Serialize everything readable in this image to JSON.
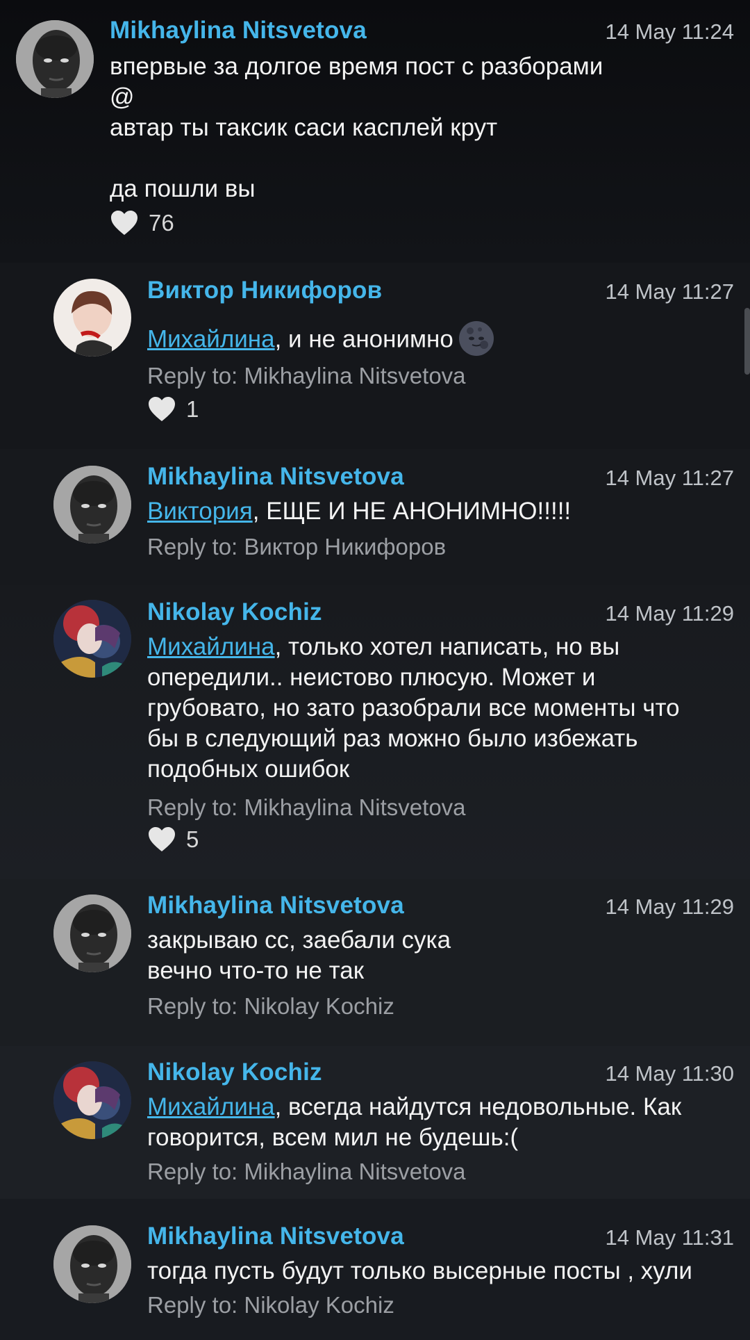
{
  "comments": [
    {
      "author": "Mikhaylina Nitsvetova",
      "time": "14 May 11:24",
      "text": "впервые за долгое время пост с разборами\n@\nавтар ты таксик саси касплей крут\n\nда пошли вы",
      "likes": "76"
    },
    {
      "author": "Виктор Никифоров",
      "time": "14 May 11:27",
      "mention": "Михайлина",
      "text": ", и не анонимно",
      "emoji": "new-moon-face-emoji",
      "reply": "Reply to: Mikhaylina Nitsvetova",
      "likes": "1"
    },
    {
      "author": "Mikhaylina Nitsvetova",
      "time": "14 May 11:27",
      "mention": "Виктория",
      "text": ", ЕЩЕ И НЕ АНОНИМНО!!!!!",
      "reply": "Reply to: Виктор Никифоров"
    },
    {
      "author": "Nikolay Kochiz",
      "time": "14 May 11:29",
      "mention": "Михайлина",
      "text": ", только хотел написать, но вы\nопередили.. неистово плюсую. Может и\nгрубовато, но зато разобрали все моменты что\nбы в следующий раз можно было избежать\nподобных ошибок",
      "reply": "Reply to: Mikhaylina Nitsvetova",
      "likes": "5"
    },
    {
      "author": "Mikhaylina Nitsvetova",
      "time": "14 May 11:29",
      "text": "закрываю сс, заебали сука\nвечно что-то не так",
      "reply": "Reply to: Nikolay Kochiz"
    },
    {
      "author": "Nikolay Kochiz",
      "time": "14 May 11:30",
      "mention": "Михайлина",
      "text": ", всегда найдутся недовольные. Как\nговорится, всем мил не будешь:(",
      "reply": "Reply to: Mikhaylina Nitsvetova"
    },
    {
      "author": "Mikhaylina Nitsvetova",
      "time": "14 May 11:31",
      "text": "тогда пусть будут только высерные посты , хули",
      "reply": "Reply to: Nikolay Kochiz"
    }
  ],
  "colors": {
    "accent": "#45b6ea",
    "background": "#0d0f12",
    "meta": "#9c9fa4"
  }
}
